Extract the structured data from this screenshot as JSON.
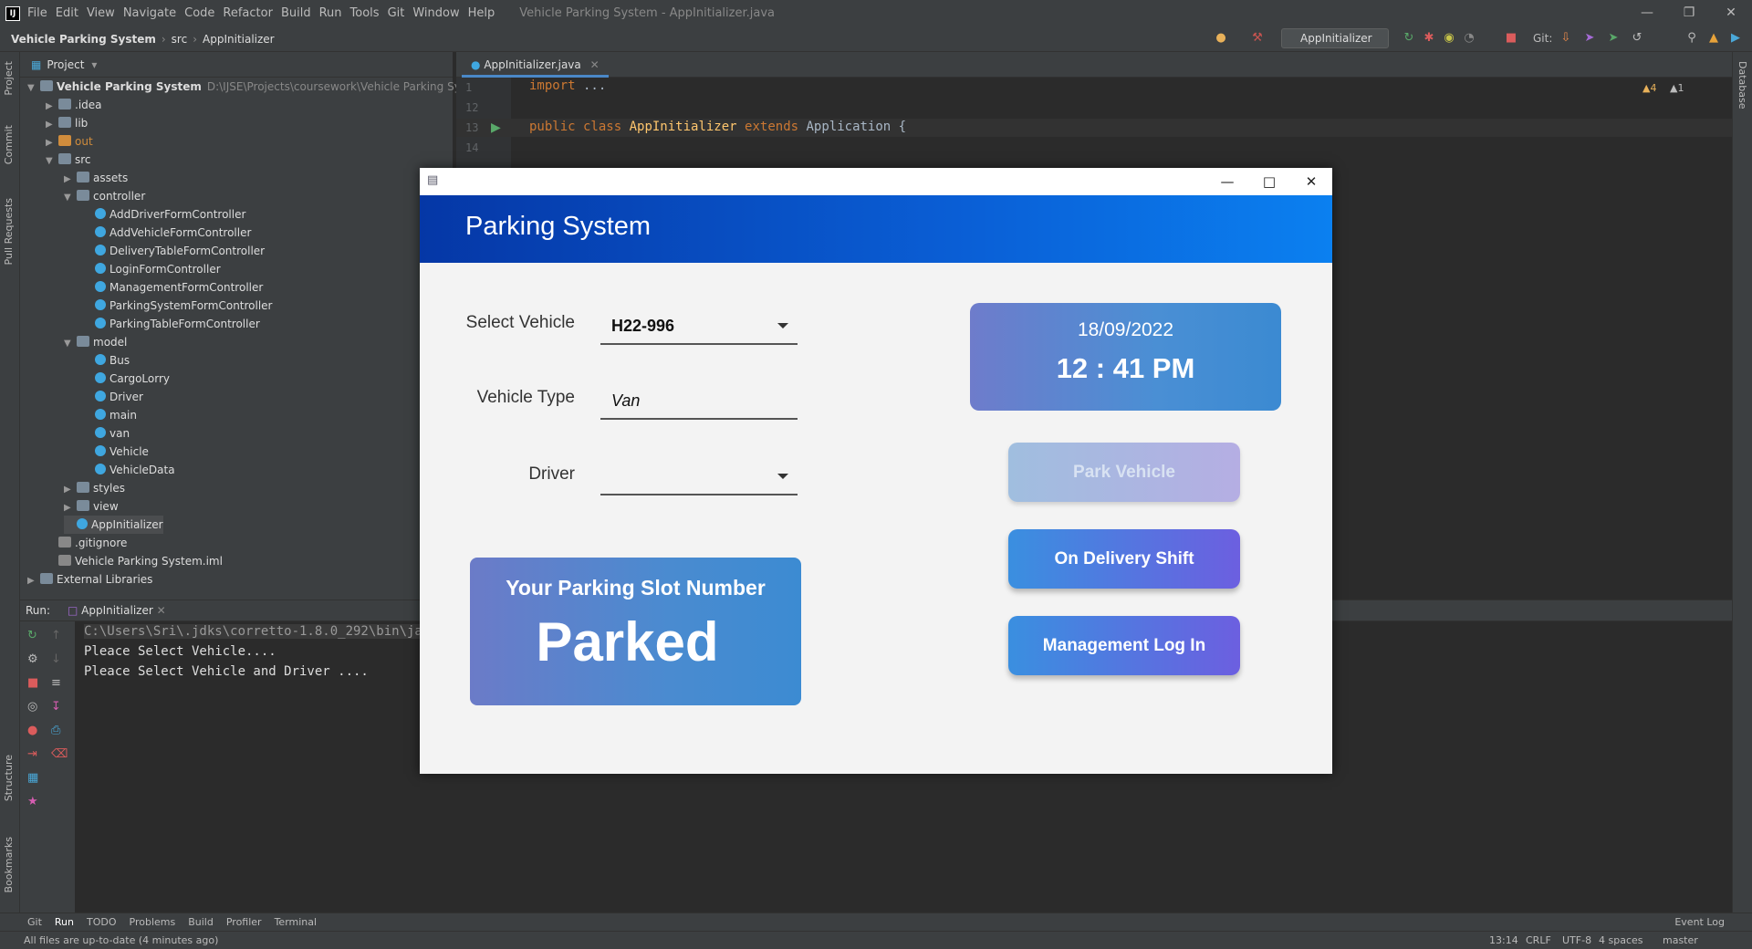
{
  "menu": {
    "items": [
      "File",
      "Edit",
      "View",
      "Navigate",
      "Code",
      "Refactor",
      "Build",
      "Run",
      "Tools",
      "Git",
      "Window",
      "Help"
    ],
    "window_title": "Vehicle Parking System - AppInitializer.java"
  },
  "breadcrumb": {
    "project": "Vehicle Parking System",
    "src": "src",
    "file": "AppInitializer"
  },
  "toolbar": {
    "run_config": "AppInitializer",
    "git_label": "Git:"
  },
  "left_stripe": {
    "project": "Project",
    "commit": "Commit",
    "pull_requests": "Pull Requests",
    "structure": "Structure",
    "bookmarks": "Bookmarks"
  },
  "right_stripe": {
    "database": "Database"
  },
  "project_panel": {
    "title": "Project",
    "root": "Vehicle Parking System",
    "root_path": "D:\\IJSE\\Projects\\coursework\\Vehicle Parking System",
    "tree": [
      {
        "label": ".idea"
      },
      {
        "label": "lib"
      },
      {
        "label": "out"
      },
      {
        "label": "src"
      },
      {
        "label": "assets"
      },
      {
        "label": "controller"
      },
      {
        "label": "AddDriverFormController"
      },
      {
        "label": "AddVehicleFormController"
      },
      {
        "label": "DeliveryTableFormController"
      },
      {
        "label": "LoginFormController"
      },
      {
        "label": "ManagementFormController"
      },
      {
        "label": "ParkingSystemFormController"
      },
      {
        "label": "ParkingTableFormController"
      },
      {
        "label": "model"
      },
      {
        "label": "Bus"
      },
      {
        "label": "CargoLorry"
      },
      {
        "label": "Driver"
      },
      {
        "label": "main"
      },
      {
        "label": "van"
      },
      {
        "label": "Vehicle"
      },
      {
        "label": "VehicleData"
      },
      {
        "label": "styles"
      },
      {
        "label": "view"
      },
      {
        "label": "AppInitializer"
      },
      {
        "label": ".gitignore"
      },
      {
        "label": "Vehicle Parking System.iml"
      },
      {
        "label": "External Libraries"
      }
    ]
  },
  "editor": {
    "tab": "AppInitializer.java",
    "warnings": "4",
    "weak_warnings": "1",
    "lines": [
      {
        "num": "1",
        "kw": "import",
        "rest": " ..."
      },
      {
        "num": "12",
        "kw": "",
        "rest": ""
      },
      {
        "num": "13",
        "kw": "public class",
        "cls": "AppInitializer",
        "kw2": "extends",
        "rest": " Application {"
      },
      {
        "num": "14",
        "kw": "",
        "rest": ""
      }
    ]
  },
  "run_panel": {
    "label": "Run:",
    "tab": "AppInitializer",
    "console": [
      "C:\\Users\\Sri\\.jdks\\corretto-1.8.0_292\\bin\\java",
      "Pleace Select Vehicle....",
      "Pleace Select Vehicle and Driver ...."
    ]
  },
  "bottom_tools": [
    "Git",
    "Run",
    "TODO",
    "Problems",
    "Build",
    "Profiler",
    "Terminal",
    "Event Log"
  ],
  "status": {
    "message": "All files are up-to-date (4 minutes ago)",
    "position": "13:14",
    "line_sep": "CRLF",
    "encoding": "UTF-8",
    "indent": "4 spaces",
    "branch": "master"
  },
  "app": {
    "header": "Parking System",
    "select_vehicle_label": "Select Vehicle",
    "select_vehicle_value": "H22-996",
    "vehicle_type_label": "Vehicle Type",
    "vehicle_type_value": "Van",
    "driver_label": "Driver",
    "driver_value": "",
    "date": "18/09/2022",
    "time": "12 : 41 PM",
    "slot_title": "Your Parking Slot Number",
    "slot_value": "Parked",
    "park_button": "Park Vehicle",
    "delivery_button": "On Delivery Shift",
    "management_button": "Management Log In",
    "colors": {
      "header_start": "#0537a6",
      "header_end": "#0b80f0",
      "card_start": "#6e7ccb",
      "card_end": "#3b8ad2"
    }
  }
}
